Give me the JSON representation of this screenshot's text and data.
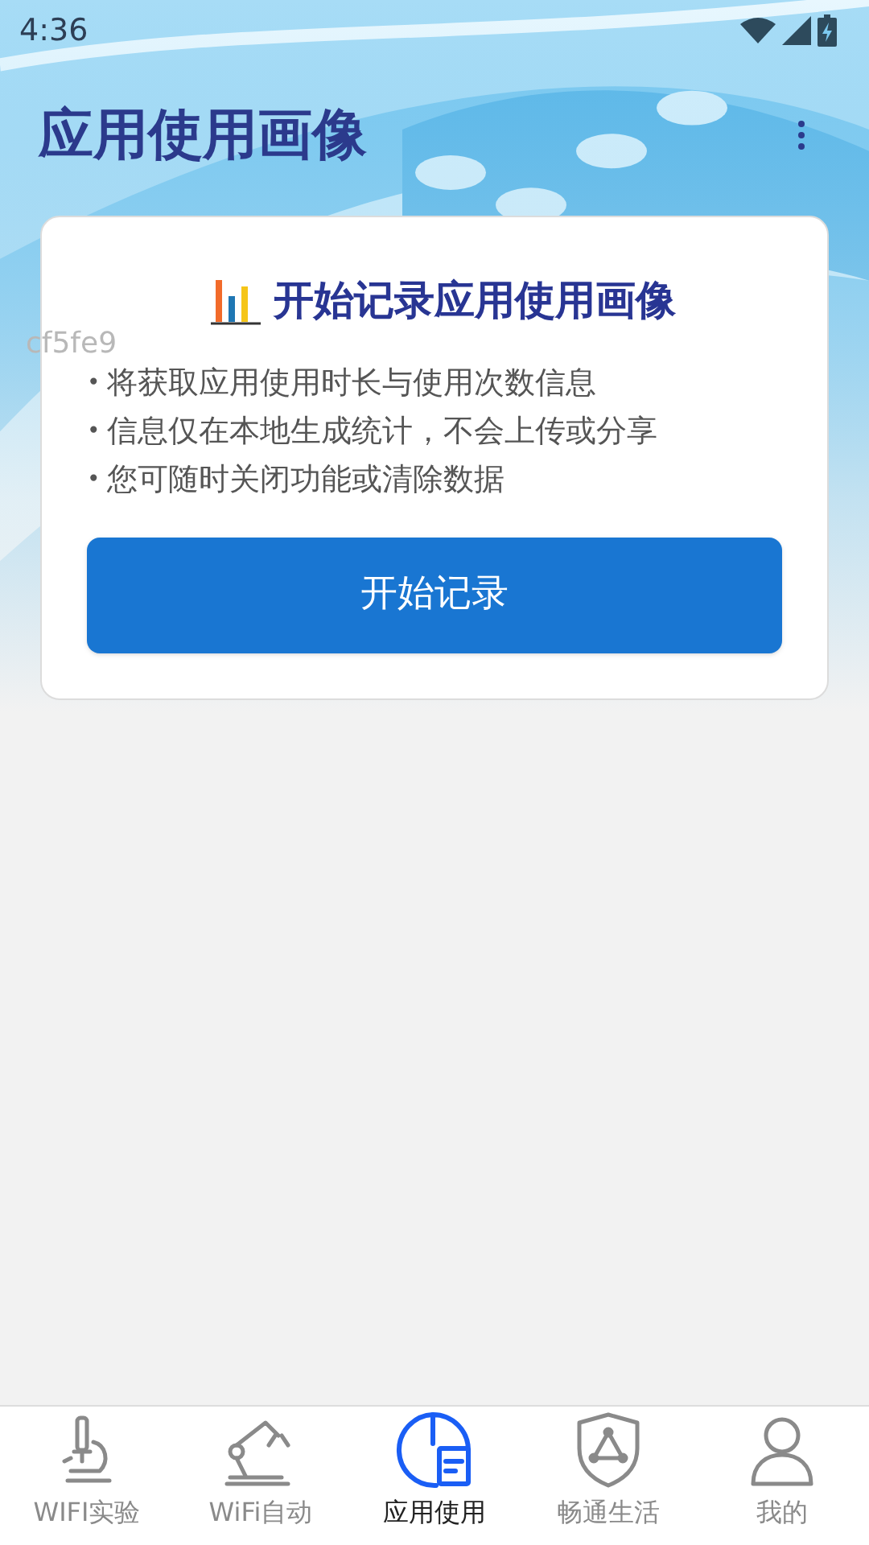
{
  "status_bar": {
    "time": "4:36"
  },
  "header": {
    "title": "应用使用画像"
  },
  "stray_text": "cf5fe9",
  "card": {
    "title": "开始记录应用使用画像",
    "bullets": [
      {
        "mark": "•",
        "text": "将获取应用使用时长与使用次数信息"
      },
      {
        "mark": "•",
        "text": "信息仅在本地生成统计，不会上传或分享"
      },
      {
        "mark": "•",
        "text": "您可随时关闭功能或清除数据"
      }
    ],
    "button": "开始记录"
  },
  "bottom_nav": [
    {
      "label": "WIFI实验",
      "kind": "microscope",
      "selected": false
    },
    {
      "label": "WiFi自动",
      "kind": "robot-arm",
      "selected": false
    },
    {
      "label": "应用使用",
      "kind": "chart-doc",
      "selected": true
    },
    {
      "label": "畅通生活",
      "kind": "shield",
      "selected": false
    },
    {
      "label": "我的",
      "kind": "user",
      "selected": false
    }
  ]
}
